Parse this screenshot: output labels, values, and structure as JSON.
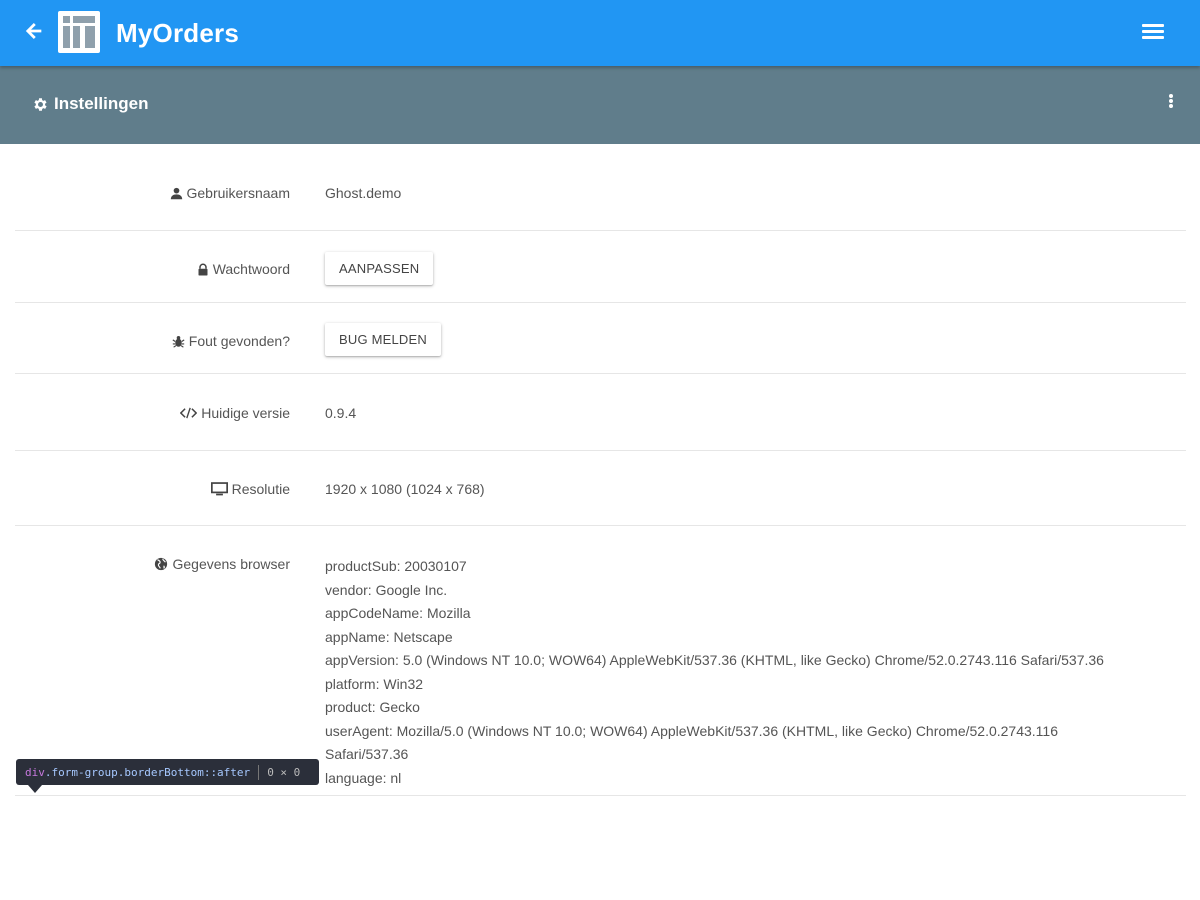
{
  "appbar": {
    "title": "MyOrders",
    "color": "#2196f3",
    "back_icon": "arrow-left-icon",
    "menu_icon": "hamburger-menu-icon"
  },
  "subbar": {
    "title": "Instellingen",
    "icon": "gear-icon",
    "color": "#607d8b",
    "more_icon": "kebab-menu-icon"
  },
  "settings": {
    "username": {
      "label": "Gebruikersnaam",
      "icon": "user-icon",
      "value": "Ghost.demo"
    },
    "password": {
      "label": "Wachtwoord",
      "icon": "lock-icon",
      "button": "AANPASSEN"
    },
    "bug": {
      "label": "Fout gevonden?",
      "icon": "bug-icon",
      "button": "BUG MELDEN"
    },
    "version": {
      "label": "Huidige versie",
      "icon": "code-icon",
      "value": "0.9.4"
    },
    "resolution": {
      "label": "Resolutie",
      "icon": "monitor-icon",
      "value": "1920 x 1080 (1024 x 768)"
    },
    "browser": {
      "label": "Gegevens browser",
      "icon": "globe-icon",
      "lines": [
        "productSub: 20030107",
        "vendor: Google Inc.",
        "appCodeName: Mozilla",
        "appName: Netscape",
        "appVersion: 5.0 (Windows NT 10.0; WOW64) AppleWebKit/537.36 (KHTML, like Gecko) Chrome/52.0.2743.116 Safari/537.36",
        "platform: Win32",
        "product: Gecko",
        "userAgent: Mozilla/5.0 (Windows NT 10.0; WOW64) AppleWebKit/537.36 (KHTML, like Gecko) Chrome/52.0.2743.116",
        "Safari/537.36",
        "language: nl"
      ]
    }
  },
  "devtools_tooltip": {
    "tag": "div",
    "selector": ".form-group.borderBottom::after",
    "size": "0 × 0"
  }
}
